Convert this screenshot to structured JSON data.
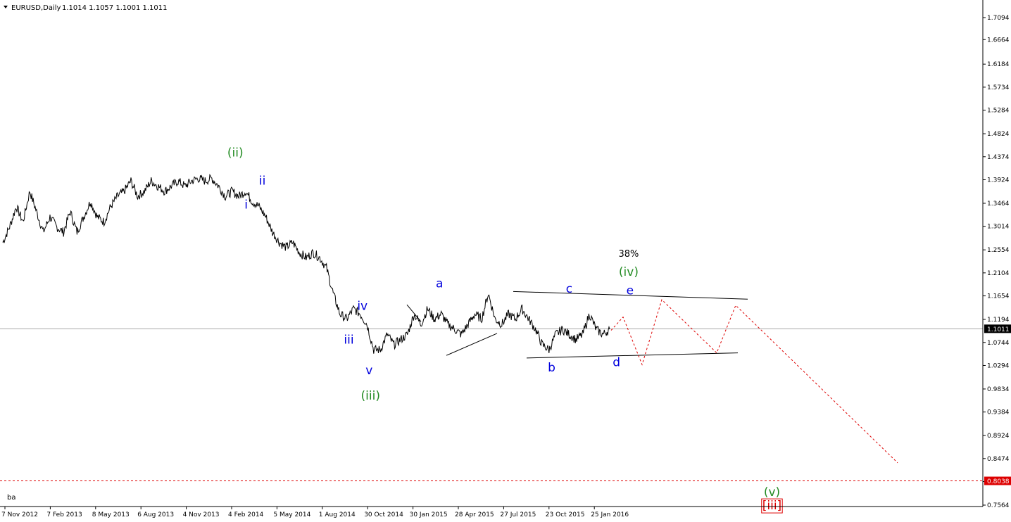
{
  "header": {
    "symbol": "EURUSD,Daily",
    "ohlc": "1.1014 1.1057 1.1001 1.1011"
  },
  "corner_label": "ba",
  "colors": {
    "price": "#000000",
    "blue": "#0000dd",
    "green": "#228b22",
    "red": "#dd0000",
    "axis": "#000000",
    "current_line": "#aaaaaa",
    "badge_bg": "#000000"
  },
  "chart_data": {
    "type": "line",
    "title": "",
    "xlabel": "",
    "ylabel": "",
    "ylim": [
      0.74,
      1.74
    ],
    "grid": false,
    "x_ticks": [
      "7 Nov 2012",
      "7 Feb 2013",
      "8 May 2013",
      "6 Aug 2013",
      "4 Nov 2013",
      "4 Feb 2014",
      "5 May 2014",
      "1 Aug 2014",
      "30 Oct 2014",
      "30 Jan 2015",
      "28 Apr 2015",
      "27 Jul 2015",
      "23 Oct 2015",
      "25 Jan 2016"
    ],
    "y_ticks": [
      "1.7094",
      "1.6664",
      "1.6184",
      "1.5734",
      "1.5284",
      "1.4824",
      "1.4374",
      "1.3924",
      "1.3464",
      "1.3014",
      "1.2554",
      "1.2104",
      "1.1654",
      "1.1194",
      "1.0744",
      "1.0294",
      "0.9834",
      "0.9384",
      "0.8924",
      "0.8474",
      "0.8024",
      "0.7564"
    ],
    "current_price": "1.1011",
    "target_price": "0.8038",
    "price_path": [
      [
        0,
        1.27
      ],
      [
        0.5,
        1.3
      ],
      [
        1.0,
        1.34
      ],
      [
        1.5,
        1.31
      ],
      [
        2.0,
        1.37
      ],
      [
        2.5,
        1.33
      ],
      [
        3.0,
        1.29
      ],
      [
        3.5,
        1.32
      ],
      [
        4.0,
        1.3
      ],
      [
        4.5,
        1.29
      ],
      [
        5.0,
        1.33
      ],
      [
        5.5,
        1.29
      ],
      [
        6.0,
        1.32
      ],
      [
        6.5,
        1.35
      ],
      [
        7.0,
        1.32
      ],
      [
        7.5,
        1.31
      ],
      [
        8.0,
        1.34
      ],
      [
        8.5,
        1.36
      ],
      [
        9.0,
        1.37
      ],
      [
        9.5,
        1.39
      ],
      [
        10.0,
        1.36
      ],
      [
        10.5,
        1.37
      ],
      [
        11.0,
        1.39
      ],
      [
        11.5,
        1.38
      ],
      [
        12.0,
        1.37
      ],
      [
        12.5,
        1.38
      ],
      [
        13.0,
        1.39
      ],
      [
        13.5,
        1.38
      ],
      [
        14.0,
        1.39
      ],
      [
        14.5,
        1.395
      ],
      [
        15.0,
        1.39
      ],
      [
        15.5,
        1.395
      ],
      [
        16.0,
        1.38
      ],
      [
        16.5,
        1.36
      ],
      [
        17.0,
        1.37
      ],
      [
        17.5,
        1.36
      ],
      [
        18.0,
        1.37
      ],
      [
        18.5,
        1.35
      ],
      [
        19.0,
        1.34
      ],
      [
        19.5,
        1.32
      ],
      [
        20.0,
        1.29
      ],
      [
        20.5,
        1.27
      ],
      [
        21.0,
        1.26
      ],
      [
        21.5,
        1.27
      ],
      [
        22.0,
        1.25
      ],
      [
        22.5,
        1.24
      ],
      [
        23.0,
        1.25
      ],
      [
        23.5,
        1.24
      ],
      [
        24.0,
        1.22
      ],
      [
        24.5,
        1.17
      ],
      [
        25.0,
        1.13
      ],
      [
        25.5,
        1.12
      ],
      [
        26.0,
        1.14
      ],
      [
        26.5,
        1.13
      ],
      [
        27.0,
        1.11
      ],
      [
        27.5,
        1.06
      ],
      [
        28.0,
        1.06
      ],
      [
        28.5,
        1.09
      ],
      [
        29.0,
        1.07
      ],
      [
        29.5,
        1.08
      ],
      [
        30.0,
        1.09
      ],
      [
        30.5,
        1.13
      ],
      [
        31.0,
        1.11
      ],
      [
        31.5,
        1.14
      ],
      [
        32.0,
        1.12
      ],
      [
        32.5,
        1.13
      ],
      [
        33.0,
        1.11
      ],
      [
        33.5,
        1.1
      ],
      [
        34.0,
        1.09
      ],
      [
        34.5,
        1.11
      ],
      [
        35.0,
        1.13
      ],
      [
        35.5,
        1.12
      ],
      [
        36.0,
        1.17
      ],
      [
        36.5,
        1.12
      ],
      [
        37.0,
        1.11
      ],
      [
        37.5,
        1.13
      ],
      [
        38.0,
        1.12
      ],
      [
        38.5,
        1.14
      ],
      [
        39.0,
        1.12
      ],
      [
        39.5,
        1.1
      ],
      [
        40.0,
        1.07
      ],
      [
        40.5,
        1.06
      ],
      [
        41.0,
        1.09
      ],
      [
        41.5,
        1.1
      ],
      [
        42.0,
        1.09
      ],
      [
        42.5,
        1.08
      ],
      [
        43.0,
        1.09
      ],
      [
        43.5,
        1.13
      ],
      [
        44.0,
        1.1
      ],
      [
        44.5,
        1.09
      ],
      [
        45.0,
        1.1
      ]
    ],
    "price_x_range": [
      0,
      45
    ],
    "price_x_end_date_tick": "25 Jan 2016",
    "projection_path": [
      [
        0,
        1.12
      ],
      [
        1,
        1.03
      ],
      [
        2,
        1.16
      ],
      [
        3,
        1.05
      ],
      [
        4,
        1.16
      ],
      [
        5,
        0.84
      ]
    ],
    "trendlines": [
      {
        "from": [
          0,
          1.174
        ],
        "to": [
          1,
          1.159
        ]
      },
      {
        "from": [
          0,
          1.044
        ],
        "to": [
          1,
          1.054
        ]
      },
      {
        "from": [
          0,
          1.049
        ],
        "to": [
          1,
          1.092
        ]
      },
      {
        "from": [
          0,
          1.148
        ],
        "to": [
          1,
          1.115
        ]
      }
    ],
    "wave_labels": [
      {
        "text": "(ii)",
        "color": "green",
        "price": 1.438,
        "at": "17.2"
      },
      {
        "text": "ii",
        "color": "blue",
        "price": 1.383,
        "at": "19.2"
      },
      {
        "text": "i",
        "color": "blue",
        "price": 1.336,
        "at": "18.0"
      },
      {
        "text": "iv",
        "color": "blue",
        "price": 1.138,
        "at": "26.6"
      },
      {
        "text": "iii",
        "color": "blue",
        "price": 1.072,
        "at": "25.6"
      },
      {
        "text": "v",
        "color": "blue",
        "price": 1.012,
        "at": "27.1"
      },
      {
        "text": "(iii)",
        "color": "green",
        "price": 0.963,
        "at": "27.2"
      },
      {
        "text": "a",
        "color": "blue",
        "price": 1.182,
        "at": "32.3"
      },
      {
        "text": "b",
        "color": "blue",
        "price": 1.018,
        "at": "40.6"
      },
      {
        "text": "c",
        "color": "blue",
        "price": 1.172,
        "at": "41.9"
      },
      {
        "text": "d",
        "color": "blue",
        "price": 1.028,
        "at": "45.4"
      },
      {
        "text": "e",
        "color": "blue",
        "price": 1.168,
        "at": "46.4"
      },
      {
        "text": "(iv)",
        "color": "green",
        "price": 1.205,
        "at": "46.3"
      },
      {
        "text": "(v)",
        "color": "green",
        "price": 0.774,
        "at": "56.9"
      },
      {
        "text": "[iii]",
        "color": "red",
        "price": 0.748,
        "at": "56.9"
      }
    ],
    "annotations": [
      {
        "text": "38%",
        "price": 1.242,
        "at": "46.3"
      }
    ]
  }
}
